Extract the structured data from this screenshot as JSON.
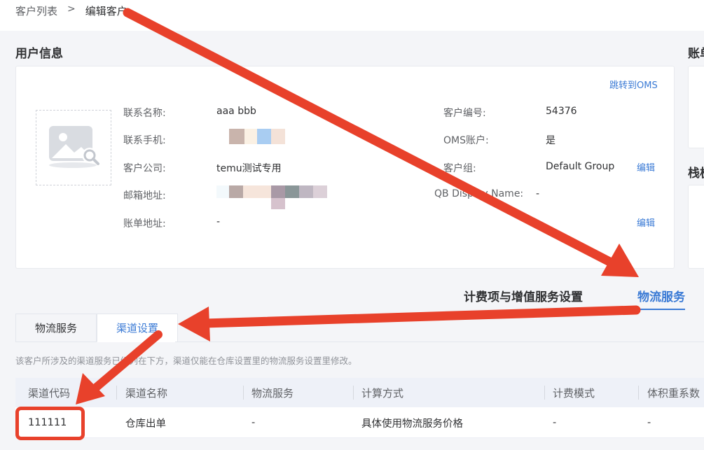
{
  "breadcrumb": {
    "parent": "客户列表",
    "separator": ">",
    "current": "编辑客户"
  },
  "user_info": {
    "title": "用户信息",
    "jump_link": "跳转到OMS",
    "avatar_icon": "image-placeholder-icon",
    "fields": {
      "contact_name_label": "联系名称:",
      "contact_name_value": "aaa bbb",
      "phone_label": "联系手机:",
      "company_label": "客户公司:",
      "company_value": "temu测试专用",
      "email_label": "邮箱地址:",
      "billing_address_label": "账单地址:",
      "billing_address_value": "-",
      "customer_no_label": "客户编号:",
      "customer_no_value": "54376",
      "oms_account_label": "OMS账户:",
      "oms_account_value": "是",
      "customer_group_label": "客户组:",
      "customer_group_value": "Default Group",
      "qb_name_label": "QB Display Name:",
      "qb_name_value": "-"
    },
    "edit_label": "编辑"
  },
  "side_titles": {
    "top": "账单",
    "bottom": "栈板"
  },
  "main_tabs": [
    {
      "label": "计费项与增值服务设置",
      "active": false
    },
    {
      "label": "物流服务",
      "active": true
    }
  ],
  "sub_tabs": [
    {
      "label": "物流服务",
      "active": false
    },
    {
      "label": "渠道设置",
      "active": true
    }
  ],
  "hint": "该客户所涉及的渠道服务已经列在下方，渠道仅能在仓库设置里的物流服务设置里修改。",
  "table": {
    "headers": [
      "渠道代码",
      "渠道名称",
      "物流服务",
      "计算方式",
      "计费模式",
      "体积重系数"
    ],
    "rows": [
      [
        "111111",
        "仓库出单",
        "-",
        "具体使用物流服务价格",
        "-",
        "-"
      ]
    ]
  },
  "colors": {
    "accent": "#3a7ad5",
    "annotation": "#e8412b"
  }
}
